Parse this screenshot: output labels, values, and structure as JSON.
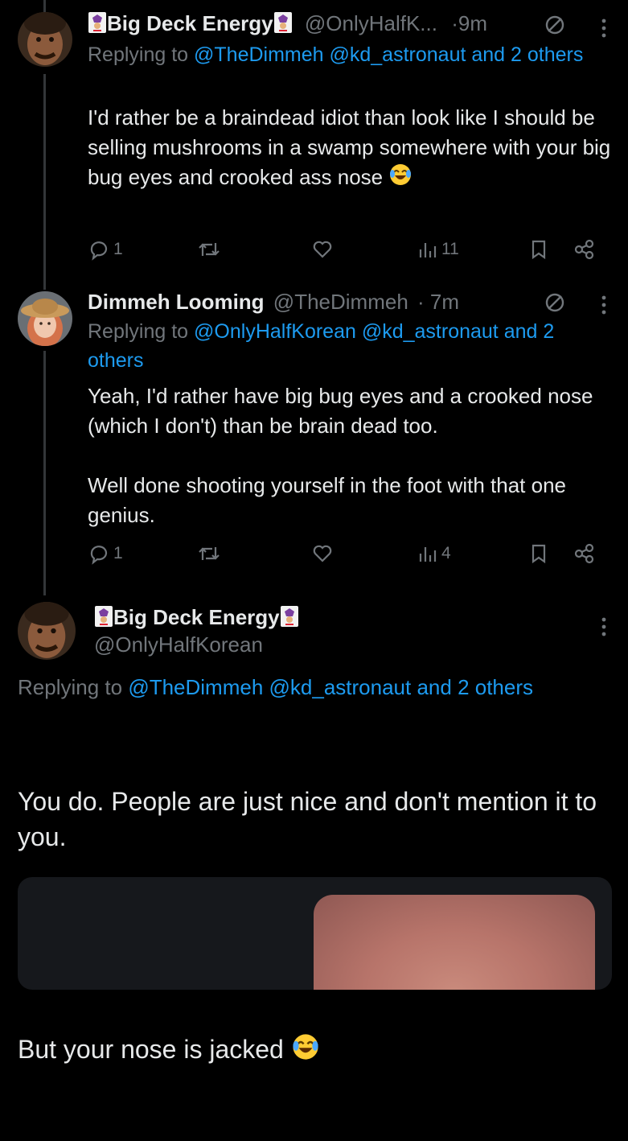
{
  "tweets": [
    {
      "name": "Big Deck Energy",
      "handle": "@OnlyHalfK...",
      "dot": "·",
      "time": "9m",
      "replying_prefix": "Replying to ",
      "replying_links": "@TheDimmeh @kd_astronaut and 2 others",
      "text": "I'd rather be a braindead idiot than look like I should be selling mushrooms in a swamp somewhere with your big bug eyes and crooked ass nose",
      "replies": "1",
      "retweets": "",
      "likes": "",
      "views": "11"
    },
    {
      "name": "Dimmeh Looming",
      "handle": "@TheDimmeh",
      "dot": "·",
      "time": "7m",
      "replying_prefix": "Replying to ",
      "replying_links": "@OnlyHalfKorean @kd_astronaut and 2 others",
      "text": "Yeah, I'd rather have big bug eyes and a crooked nose (which I don't) than be brain dead too.\n\nWell done shooting yourself in the foot with that one genius.",
      "replies": "1",
      "retweets": "",
      "likes": "",
      "views": "4"
    }
  ],
  "main_tweet": {
    "name": "Big Deck Energy",
    "handle": "@OnlyHalfKorean",
    "replying_prefix": "Replying to ",
    "replying_links": "@TheDimmeh @kd_astronaut and 2 others",
    "text_1": "You do. People are just nice and don't mention it to you.",
    "text_2": "But your nose is jacked"
  },
  "icons": {
    "reply": "reply-icon",
    "retweet": "retweet-icon",
    "like": "heart-icon",
    "views": "views-icon",
    "bookmark": "bookmark-icon",
    "share": "share-icon",
    "more": "more-icon",
    "restricted": "no-entry-icon",
    "emoji": "laughing-emoji"
  },
  "colors": {
    "background": "#000000",
    "text": "#e7e9ea",
    "muted": "#71767b",
    "link": "#1d9bf0",
    "card": "#16181c"
  }
}
